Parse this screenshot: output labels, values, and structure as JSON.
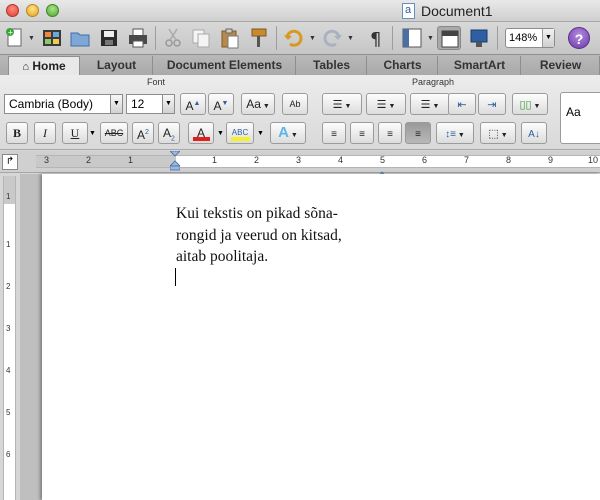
{
  "window": {
    "title": "Document1"
  },
  "toolbar": {
    "zoom": "148%",
    "help": "?"
  },
  "tabs": [
    {
      "label": "Home",
      "active": true
    },
    {
      "label": "Layout"
    },
    {
      "label": "Document Elements"
    },
    {
      "label": "Tables"
    },
    {
      "label": "Charts"
    },
    {
      "label": "SmartArt"
    },
    {
      "label": "Review"
    }
  ],
  "ribbon": {
    "font_group_label": "Font",
    "paragraph_group_label": "Paragraph",
    "font_name": "Cambria (Body)",
    "font_size": "12",
    "grow_font": "A",
    "shrink_font": "A",
    "change_case": "Aa",
    "spelling": "Ab",
    "bold": "B",
    "italic": "I",
    "underline": "U",
    "strikethrough": "ABC",
    "superscript": "A",
    "superscript_mark": "2",
    "subscript": "A",
    "subscript_mark": "2",
    "font_color": "A",
    "highlight": "ABC",
    "text_effects": "A",
    "styles_preview": "Aa"
  },
  "ruler": {
    "numbers": [
      "3",
      "2",
      "1",
      "1",
      "2",
      "3",
      "4",
      "5",
      "6",
      "7",
      "8",
      "9",
      "10"
    ],
    "vertical_numbers": [
      "1",
      "1",
      "2",
      "3",
      "4",
      "5",
      "6"
    ]
  },
  "document": {
    "lines": [
      "Kui tekstis on pikad sõna-",
      "rongid ja veerud on kitsad,",
      "aitab poolitaja."
    ]
  },
  "colors": {
    "font_color_bar": "#e0201b",
    "highlight_bar": "#f5ef2e",
    "help_purple": "#6a3aa8"
  }
}
